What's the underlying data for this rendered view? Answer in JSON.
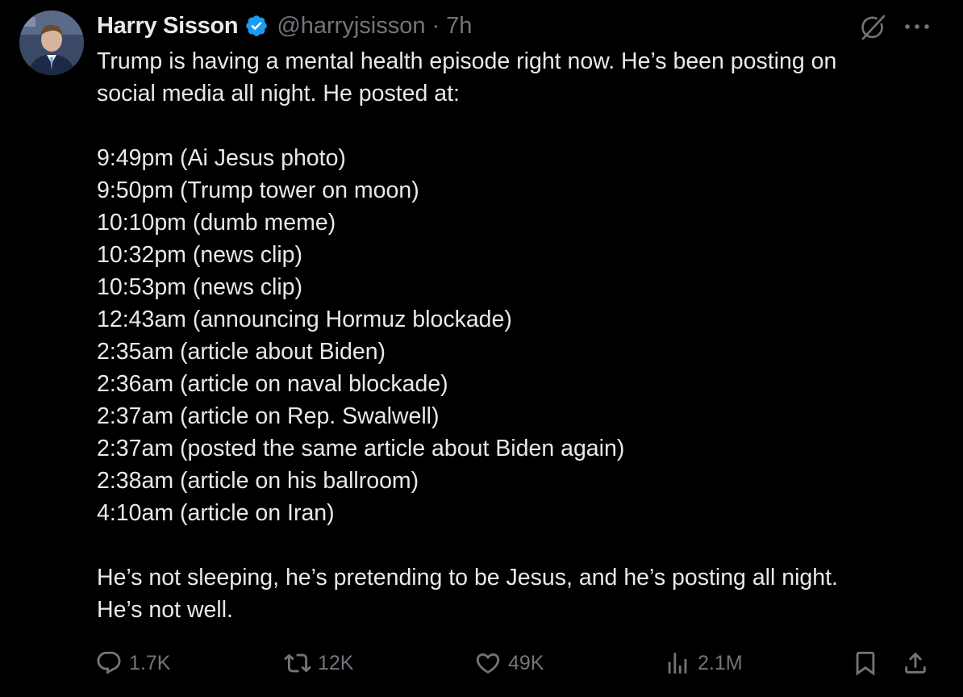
{
  "author": {
    "name": "Harry Sisson",
    "handle": "@harryjsisson",
    "separator": "·",
    "time": "7h",
    "verified": true,
    "badge_color": "#1d9bf0"
  },
  "tweet": {
    "intro_lines": [
      "Trump is having a mental health episode right now. He’s been posting on",
      "social media all night. He posted at:"
    ],
    "timeline": [
      "9:49pm (Ai Jesus photo)",
      "9:50pm (Trump tower on moon)",
      "10:10pm (dumb meme)",
      "10:32pm (news clip)",
      "10:53pm (news clip)",
      "12:43am (announcing Hormuz blockade)",
      "2:35am (article about Biden)",
      "2:36am (article on naval blockade)",
      "2:37am (article on Rep. Swalwell)",
      "2:37am (posted the same article about Biden again)",
      "2:38am (article on his ballroom)",
      "4:10am (article on Iran)"
    ],
    "outro_lines": [
      "He’s not sleeping, he’s pretending to be Jesus, and he’s posting all night.",
      "He’s not well."
    ]
  },
  "actions": {
    "replies": "1.7K",
    "reposts": "12K",
    "likes": "49K",
    "views": "2.1M"
  },
  "icons": {
    "avatar": "avatar-photo",
    "verified": "verified-badge-icon",
    "grok": "grok-icon",
    "more": "more-icon",
    "reply": "reply-icon",
    "repost": "repost-icon",
    "like": "heart-icon",
    "views": "views-icon",
    "bookmark": "bookmark-icon",
    "share": "share-icon"
  },
  "colors": {
    "background": "#000000",
    "text": "#e7e9ea",
    "muted": "#71767b"
  }
}
